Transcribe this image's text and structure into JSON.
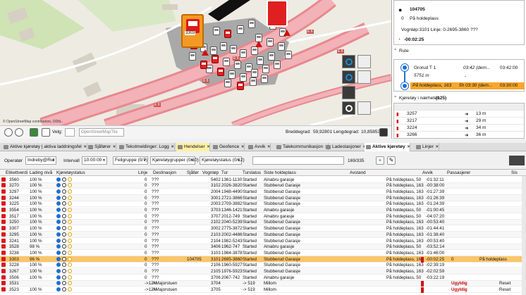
{
  "map": {
    "credit": "© OpenStreetMap contributors, ODbL.",
    "road_labels": [
      "E 6",
      "E 6",
      "E 6",
      "E 6",
      "E 6"
    ],
    "sel_vehicle_label": "3303",
    "bottom": {
      "velg_label": "Velg:",
      "map_source": "OpenStreetMapTile",
      "bredde_label": "Breddegrad:",
      "bredde_value": "59,92801",
      "lengde_label": "Lengdegrad:",
      "lengde_value": "10,85853"
    }
  },
  "panel": {
    "vehicle_id": "104705",
    "passengers_line": "På holdeplass",
    "passengers_count": "0",
    "vognlop_line": "Vognløp:3101 Linje: 0-2695-3860 ???",
    "delay": "-00:02:25",
    "route_header": "Rute",
    "route_stops": [
      {
        "name": "Grorud T 1",
        "planned": "03:42 (dem...",
        "actual": "03:42:00",
        "dist": "5751 m",
        "note": "-"
      },
      {
        "name": "På holdeplass, 163",
        "planned": "5h 03:30 (dem...",
        "actual": "03:30:00"
      }
    ],
    "nearby_header": "Kjøretøy i nærheten",
    "nearby_count": "(125)",
    "nearby": [
      {
        "id": "3257",
        "dist": "13 m"
      },
      {
        "id": "3217",
        "dist": "29 m"
      },
      {
        "id": "3224",
        "dist": "34 m"
      },
      {
        "id": "3266",
        "dist": "36 m"
      }
    ]
  },
  "tabs": [
    {
      "label": "Aktive kjøretøy | aktiva laddningsfel",
      "active": false
    },
    {
      "label": "Sjåfører",
      "active": false
    },
    {
      "label": "Tekstmeldinger: Logg",
      "active": false
    },
    {
      "label": "Hendelser",
      "active": "yellow"
    },
    {
      "label": "Geofence",
      "active": false
    },
    {
      "label": "Avvik",
      "active": false
    },
    {
      "label": "Talekommunikasjon",
      "active": false
    },
    {
      "label": "Ladestasjoner",
      "active": false
    },
    {
      "label": "Aktive kjøretøy",
      "active": "white"
    },
    {
      "label": "Linjer",
      "active": false
    }
  ],
  "filters": {
    "operator_label": "Operatør",
    "operator_value": "Indreby@Rut",
    "interval_label": "Intervall",
    "interval_value": "10:00:00",
    "feilgruppe_value": "Feilgruppe (0/7)",
    "kjoretoygrupper_value": "Kjøretøygrupper (0/10)",
    "kjoretoystatus_value": "Kjøretøystatus (0/12)",
    "search_value": "",
    "count": "169/335"
  },
  "columns": [
    "Etikettverdi",
    "Lading nivå",
    "Kjøretøystatus",
    "Linje",
    "Destinasjon",
    "Sjåfør",
    "Vognløp",
    "Tur",
    "Turstatus",
    "Siste holdeplass",
    "Avstand",
    "Avvik",
    "Passasjerer",
    "Sis"
  ],
  "rows": [
    {
      "id": "3560",
      "lvl": "100 %",
      "linje": "0",
      "dest": "???",
      "sjafor": "",
      "vognlop": "5402",
      "tur": "1361-1130",
      "status": "Started",
      "stop": "Alnabru garasje",
      "avstand": "På holdeplass, 50",
      "avvik": "-01:32:11",
      "pass": "",
      "late": false
    },
    {
      "id": "3270",
      "lvl": "100 %",
      "linje": "0",
      "dest": "???",
      "sjafor": "",
      "vognlop": "3102",
      "tur": "2026-3820",
      "status": "Started",
      "stop": "Stubberud Garasje",
      "avstand": "På holdeplass, 163",
      "avvik": "-00:38:00",
      "pass": "",
      "late": false
    },
    {
      "id": "3297",
      "lvl": "100 %",
      "linje": "0",
      "dest": "???",
      "sjafor": "",
      "vognlop": "2004",
      "tur": "1948-4490",
      "status": "Started",
      "stop": "Stubberud Garasje",
      "avstand": "På holdeplass, 163",
      "avvik": "-01:27:39",
      "pass": "",
      "late": false
    },
    {
      "id": "3244",
      "lvl": "100 %",
      "linje": "0",
      "dest": "???",
      "sjafor": "",
      "vognlop": "3001",
      "tur": "2721-3866",
      "status": "Started",
      "stop": "Stubberud Garasje",
      "avstand": "På holdeplass, 163",
      "avvik": "-01:26:39",
      "pass": "",
      "late": false
    },
    {
      "id": "3225",
      "lvl": "100 %",
      "linje": "0",
      "dest": "???",
      "sjafor": "",
      "vognlop": "2003",
      "tur": "2709-3882",
      "status": "Started",
      "stop": "Stubberud Garasje",
      "avstand": "På holdeplass, 163",
      "avvik": "-01:24:39",
      "pass": "",
      "late": false
    },
    {
      "id": "3554",
      "lvl": "100 %",
      "linje": "0",
      "dest": "???",
      "sjafor": "",
      "vognlop": "3703",
      "tur": "1346-1421",
      "status": "Started",
      "stop": "Alnabru garasje",
      "avstand": "På holdeplass, 50",
      "avvik": "-01:00:45",
      "pass": "",
      "late": false
    },
    {
      "id": "3517",
      "lvl": "100 %",
      "linje": "0",
      "dest": "???",
      "sjafor": "",
      "vognlop": "3707",
      "tur": "2012-749",
      "status": "Started",
      "stop": "Alnabru garasje",
      "avstand": "På holdeplass, 50",
      "avvik": "-04:07:20",
      "pass": "",
      "late": false
    },
    {
      "id": "3250",
      "lvl": "100 %",
      "linje": "0",
      "dest": "???",
      "sjafor": "",
      "vognlop": "2102",
      "tur": "2040-5239",
      "status": "Started",
      "stop": "Stubberud Garasje",
      "avstand": "På holdeplass, 163",
      "avvik": "-00:53:40",
      "pass": "",
      "late": false
    },
    {
      "id": "3307",
      "lvl": "100 %",
      "linje": "0",
      "dest": "???",
      "sjafor": "",
      "vognlop": "3002",
      "tur": "2775-3872",
      "status": "Started",
      "stop": "Stubberud Garasje",
      "avstand": "På holdeplass, 163",
      "avvik": "-01:44:41",
      "pass": "",
      "late": false
    },
    {
      "id": "3295",
      "lvl": "100 %",
      "linje": "0",
      "dest": "???",
      "sjafor": "",
      "vognlop": "2103",
      "tur": "2002-4486",
      "status": "Started",
      "stop": "Stubberud Garasje",
      "avstand": "På holdeplass, 163",
      "avvik": "-01:38:40",
      "pass": "",
      "late": false
    },
    {
      "id": "3241",
      "lvl": "100 %",
      "linje": "0",
      "dest": "???",
      "sjafor": "",
      "vognlop": "2104",
      "tur": "1982-5243",
      "status": "Started",
      "stop": "Stubberud Garasje",
      "avstand": "På holdeplass, 163",
      "avvik": "-00:53:40",
      "pass": "",
      "late": false
    },
    {
      "id": "3528",
      "lvl": "98 %",
      "linje": "0",
      "dest": "???",
      "sjafor": "",
      "vognlop": "3406",
      "tur": "1962-747",
      "status": "Started",
      "stop": "Alnabru garasje",
      "avstand": "På holdeplass, 50",
      "avvik": "-03:52:14",
      "pass": "",
      "late": false
    },
    {
      "id": "3238",
      "lvl": "100 %",
      "linje": "0",
      "dest": "???",
      "sjafor": "",
      "vognlop": "3103",
      "tur": "1984-3878",
      "status": "Started",
      "stop": "Stubberud Garasje",
      "avstand": "På holdeplass, 163",
      "avvik": "-01:46:00",
      "pass": "",
      "late": false
    },
    {
      "id": "3303",
      "lvl": "96 %",
      "linje": "0",
      "dest": "???",
      "sjafor": "104705",
      "vognlop": "3101",
      "tur": "2695-3860",
      "status": "Started",
      "stop": "Stubberud Garasje",
      "avstand": "På holdeplass, 163",
      "avvik": "-00:02:25",
      "pass": "0",
      "pass2": "På holdeplass",
      "selected": true,
      "late": true
    },
    {
      "id": "3228",
      "lvl": "100 %",
      "linje": "0",
      "dest": "???",
      "sjafor": "",
      "vognlop": "2106",
      "tur": "1960-5927",
      "status": "Started",
      "stop": "Stubberud Garasje",
      "avstand": "På holdeplass, 163",
      "avvik": "-02:39:19",
      "pass": "",
      "late": false
    },
    {
      "id": "3267",
      "lvl": "100 %",
      "linje": "0",
      "dest": "???",
      "sjafor": "",
      "vognlop": "2105",
      "tur": "1976-5923",
      "status": "Started",
      "stop": "Stubberud Garasje",
      "avstand": "På holdeplass, 163",
      "avvik": "-02:02:59",
      "pass": "",
      "late": false
    },
    {
      "id": "3506",
      "lvl": "100 %",
      "linje": "0",
      "dest": "???",
      "sjafor": "",
      "vognlop": "3706",
      "tur": "2067-742",
      "status": "Started",
      "stop": "Alnabru garasje",
      "avstand": "På holdeplass, 50",
      "avvik": "-03:22:19",
      "pass": "",
      "late": false
    },
    {
      "id": "3531",
      "lvl": "",
      "linje": "->12N",
      "dest": "->Majorstuen",
      "sjafor": "",
      "vognlop": "3704",
      "tur": "",
      "status": "-> 519",
      "stop": "Millom",
      "avstand": "",
      "avvik": "",
      "pass": "Ugyldig",
      "reset": "Reset",
      "late": true
    },
    {
      "id": "3523",
      "lvl": "100 %",
      "linje": "->12N",
      "dest": "->Majorstuen",
      "sjafor": "",
      "vognlop": "3705",
      "tur": "",
      "status": "-> 519",
      "stop": "Millom",
      "avstand": "",
      "avvik": "",
      "pass": "Ugyldig",
      "reset": "Reset",
      "late": true
    }
  ]
}
